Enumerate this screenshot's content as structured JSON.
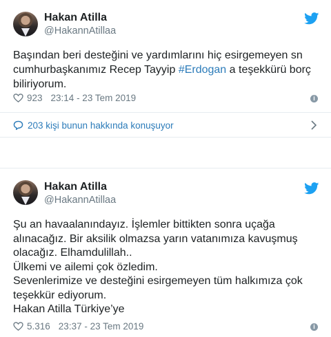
{
  "tweet1": {
    "author_name": "Hakan Atilla",
    "handle": "@HakannAtillaa",
    "text_before": "Başından beri desteğini ve yardımlarını hiç esirgemeyen sn\ncumhurbaşkanımız Recep Tayyip ",
    "hashtag": "#Erdogan",
    "text_after": " a teşekkürü borç\nbiliriyorum.",
    "likes": "923",
    "timestamp": "23:14 - 23 Tem 2019",
    "replies_label": "203 kişi bunun hakkında konuşuyor"
  },
  "tweet2": {
    "author_name": "Hakan Atilla",
    "handle": "@HakannAtillaa",
    "text": "Şu an havaalanındayız. İşlemler bittikten sonra uçağa\nalınacağız. Bir aksilik olmazsa yarın vatanımıza kavuşmuş\nolacağız. Elhamdulillah..\nÜlkemi ve ailemi çok özledim.\nSevenlerimize ve desteğini esirgemeyen tüm halkımıza çok\nteşekkür ediyorum.\nHakan Atilla Türkiye’ye",
    "likes": "5.316",
    "timestamp": "23:37 - 23 Tem 2019"
  },
  "colors": {
    "link": "#2b7bb9",
    "twitter_blue": "#1da1f2",
    "muted": "#697882"
  },
  "icons": [
    "twitter-bird-icon",
    "heart-icon",
    "info-icon",
    "reply-bubble-icon",
    "chevron-right-icon"
  ]
}
